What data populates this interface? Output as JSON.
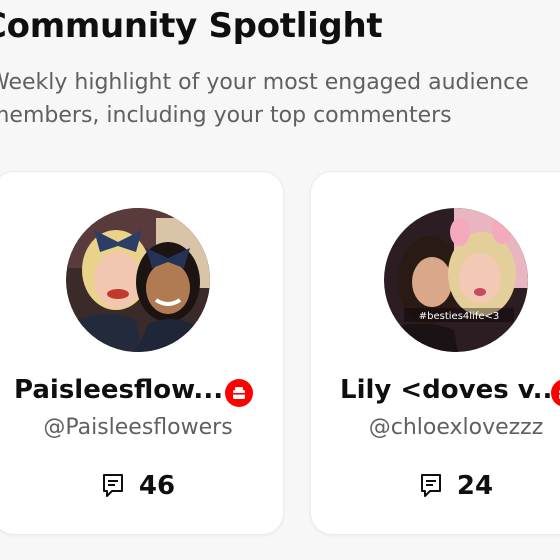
{
  "section": {
    "title": "Community Spotlight",
    "subtitle": "Weekly highlight of your most engaged audience members, including your top commenters"
  },
  "cards": [
    {
      "name": "Paisleesflow...",
      "handle": "@Paisleesflowers",
      "comment_count": "46",
      "avatar_icon": "profile-photo",
      "badge_icon": "member-gift-icon",
      "accent_color": "#ff0000"
    },
    {
      "name": "Lily <doves v...",
      "handle": "@chloexlovezzz",
      "comment_count": "24",
      "avatar_icon": "profile-photo",
      "badge_icon": "member-gift-icon",
      "accent_color": "#ff0000"
    }
  ]
}
